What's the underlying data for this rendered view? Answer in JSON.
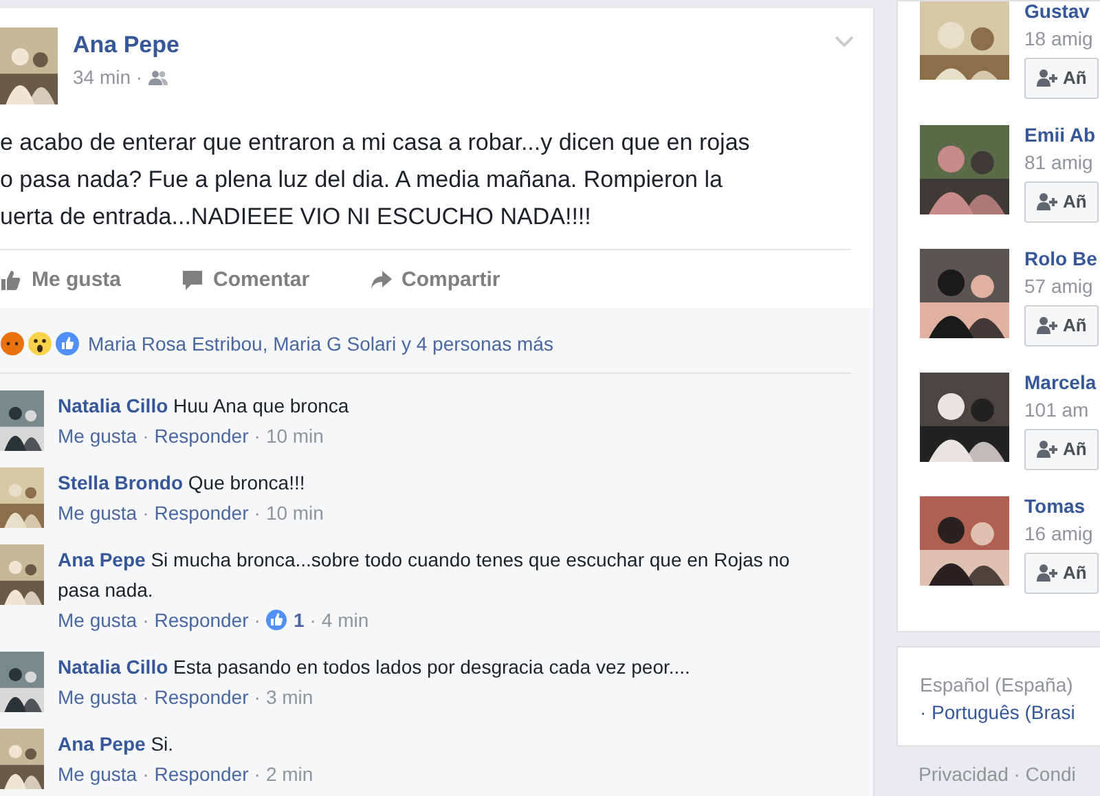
{
  "post": {
    "author": "Ana Pepe",
    "time": "34 min ·",
    "text": "e acabo de enterar que entraron a mi casa a robar...y dicen que en rojas\no pasa nada? Fue a plena luz del dia. A media mañana. Rompieron la\nuerta de entrada...NADIEEE VIO NI ESCUCHO NADA!!!!",
    "actions": [
      {
        "kind": "like",
        "label": "Me gusta"
      },
      {
        "kind": "comment",
        "label": "Comentar"
      },
      {
        "kind": "share",
        "label": "Compartir"
      }
    ],
    "reactions": {
      "icons": [
        {
          "kind": "angry"
        },
        {
          "kind": "wow"
        },
        {
          "kind": "like"
        }
      ],
      "summary": "Maria Rosa Estribou, Maria G Solari y 4 personas más"
    },
    "comments": [
      {
        "author": "Natalia Cillo",
        "text": "Huu Ana que bronca",
        "meta": [
          {
            "kind": "like",
            "text": "Me gusta"
          },
          {
            "kind": "sep",
            "text": "·"
          },
          {
            "kind": "reply",
            "text": "Responder"
          },
          {
            "kind": "sep",
            "text": "·"
          },
          {
            "kind": "time",
            "text": "10 min"
          }
        ]
      },
      {
        "author": "Stella Brondo",
        "text": "Que bronca!!!",
        "meta": [
          {
            "kind": "like",
            "text": "Me gusta"
          },
          {
            "kind": "sep",
            "text": "·"
          },
          {
            "kind": "reply",
            "text": "Responder"
          },
          {
            "kind": "sep",
            "text": "·"
          },
          {
            "kind": "time",
            "text": "10 min"
          }
        ]
      },
      {
        "author": "Ana Pepe",
        "text": "Si mucha bronca...sobre todo cuando tenes que escuchar que en Rojas no pasa nada.",
        "meta": [
          {
            "kind": "like",
            "text": "Me gusta"
          },
          {
            "kind": "sep",
            "text": "·"
          },
          {
            "kind": "reply",
            "text": "Responder"
          },
          {
            "kind": "sep",
            "text": "·"
          },
          {
            "kind": "likes",
            "text": "1"
          },
          {
            "kind": "sep",
            "text": "·"
          },
          {
            "kind": "time",
            "text": "4 min"
          }
        ]
      },
      {
        "author": "Natalia Cillo",
        "text": "Esta pasando en todos lados por desgracia cada vez peor....",
        "meta": [
          {
            "kind": "like",
            "text": "Me gusta"
          },
          {
            "kind": "sep",
            "text": "·"
          },
          {
            "kind": "reply",
            "text": "Responder"
          },
          {
            "kind": "sep",
            "text": "·"
          },
          {
            "kind": "time",
            "text": "3 min"
          }
        ]
      },
      {
        "author": "Ana Pepe",
        "text": "Si.",
        "meta": [
          {
            "kind": "like",
            "text": "Me gusta"
          },
          {
            "kind": "sep",
            "text": "·"
          },
          {
            "kind": "reply",
            "text": "Responder"
          },
          {
            "kind": "sep",
            "text": "·"
          },
          {
            "kind": "time",
            "text": "2 min"
          }
        ]
      }
    ]
  },
  "suggestions": [
    {
      "name": "Gustav",
      "friends": "18 amig",
      "button": "Añ"
    },
    {
      "name": "Emii Ab",
      "friends": "81 amig",
      "button": "Añ"
    },
    {
      "name": "Rolo Be",
      "friends": "57 amig",
      "button": "Añ"
    },
    {
      "name": "Marcela",
      "friends": "101 am",
      "button": "Añ"
    },
    {
      "name": "Tomas",
      "friends": "16 amig",
      "button": "Añ"
    }
  ],
  "languages": {
    "current": "Español (España)",
    "other": "· Português (Brasi"
  },
  "footer_links": "Privacidad · Condi"
}
